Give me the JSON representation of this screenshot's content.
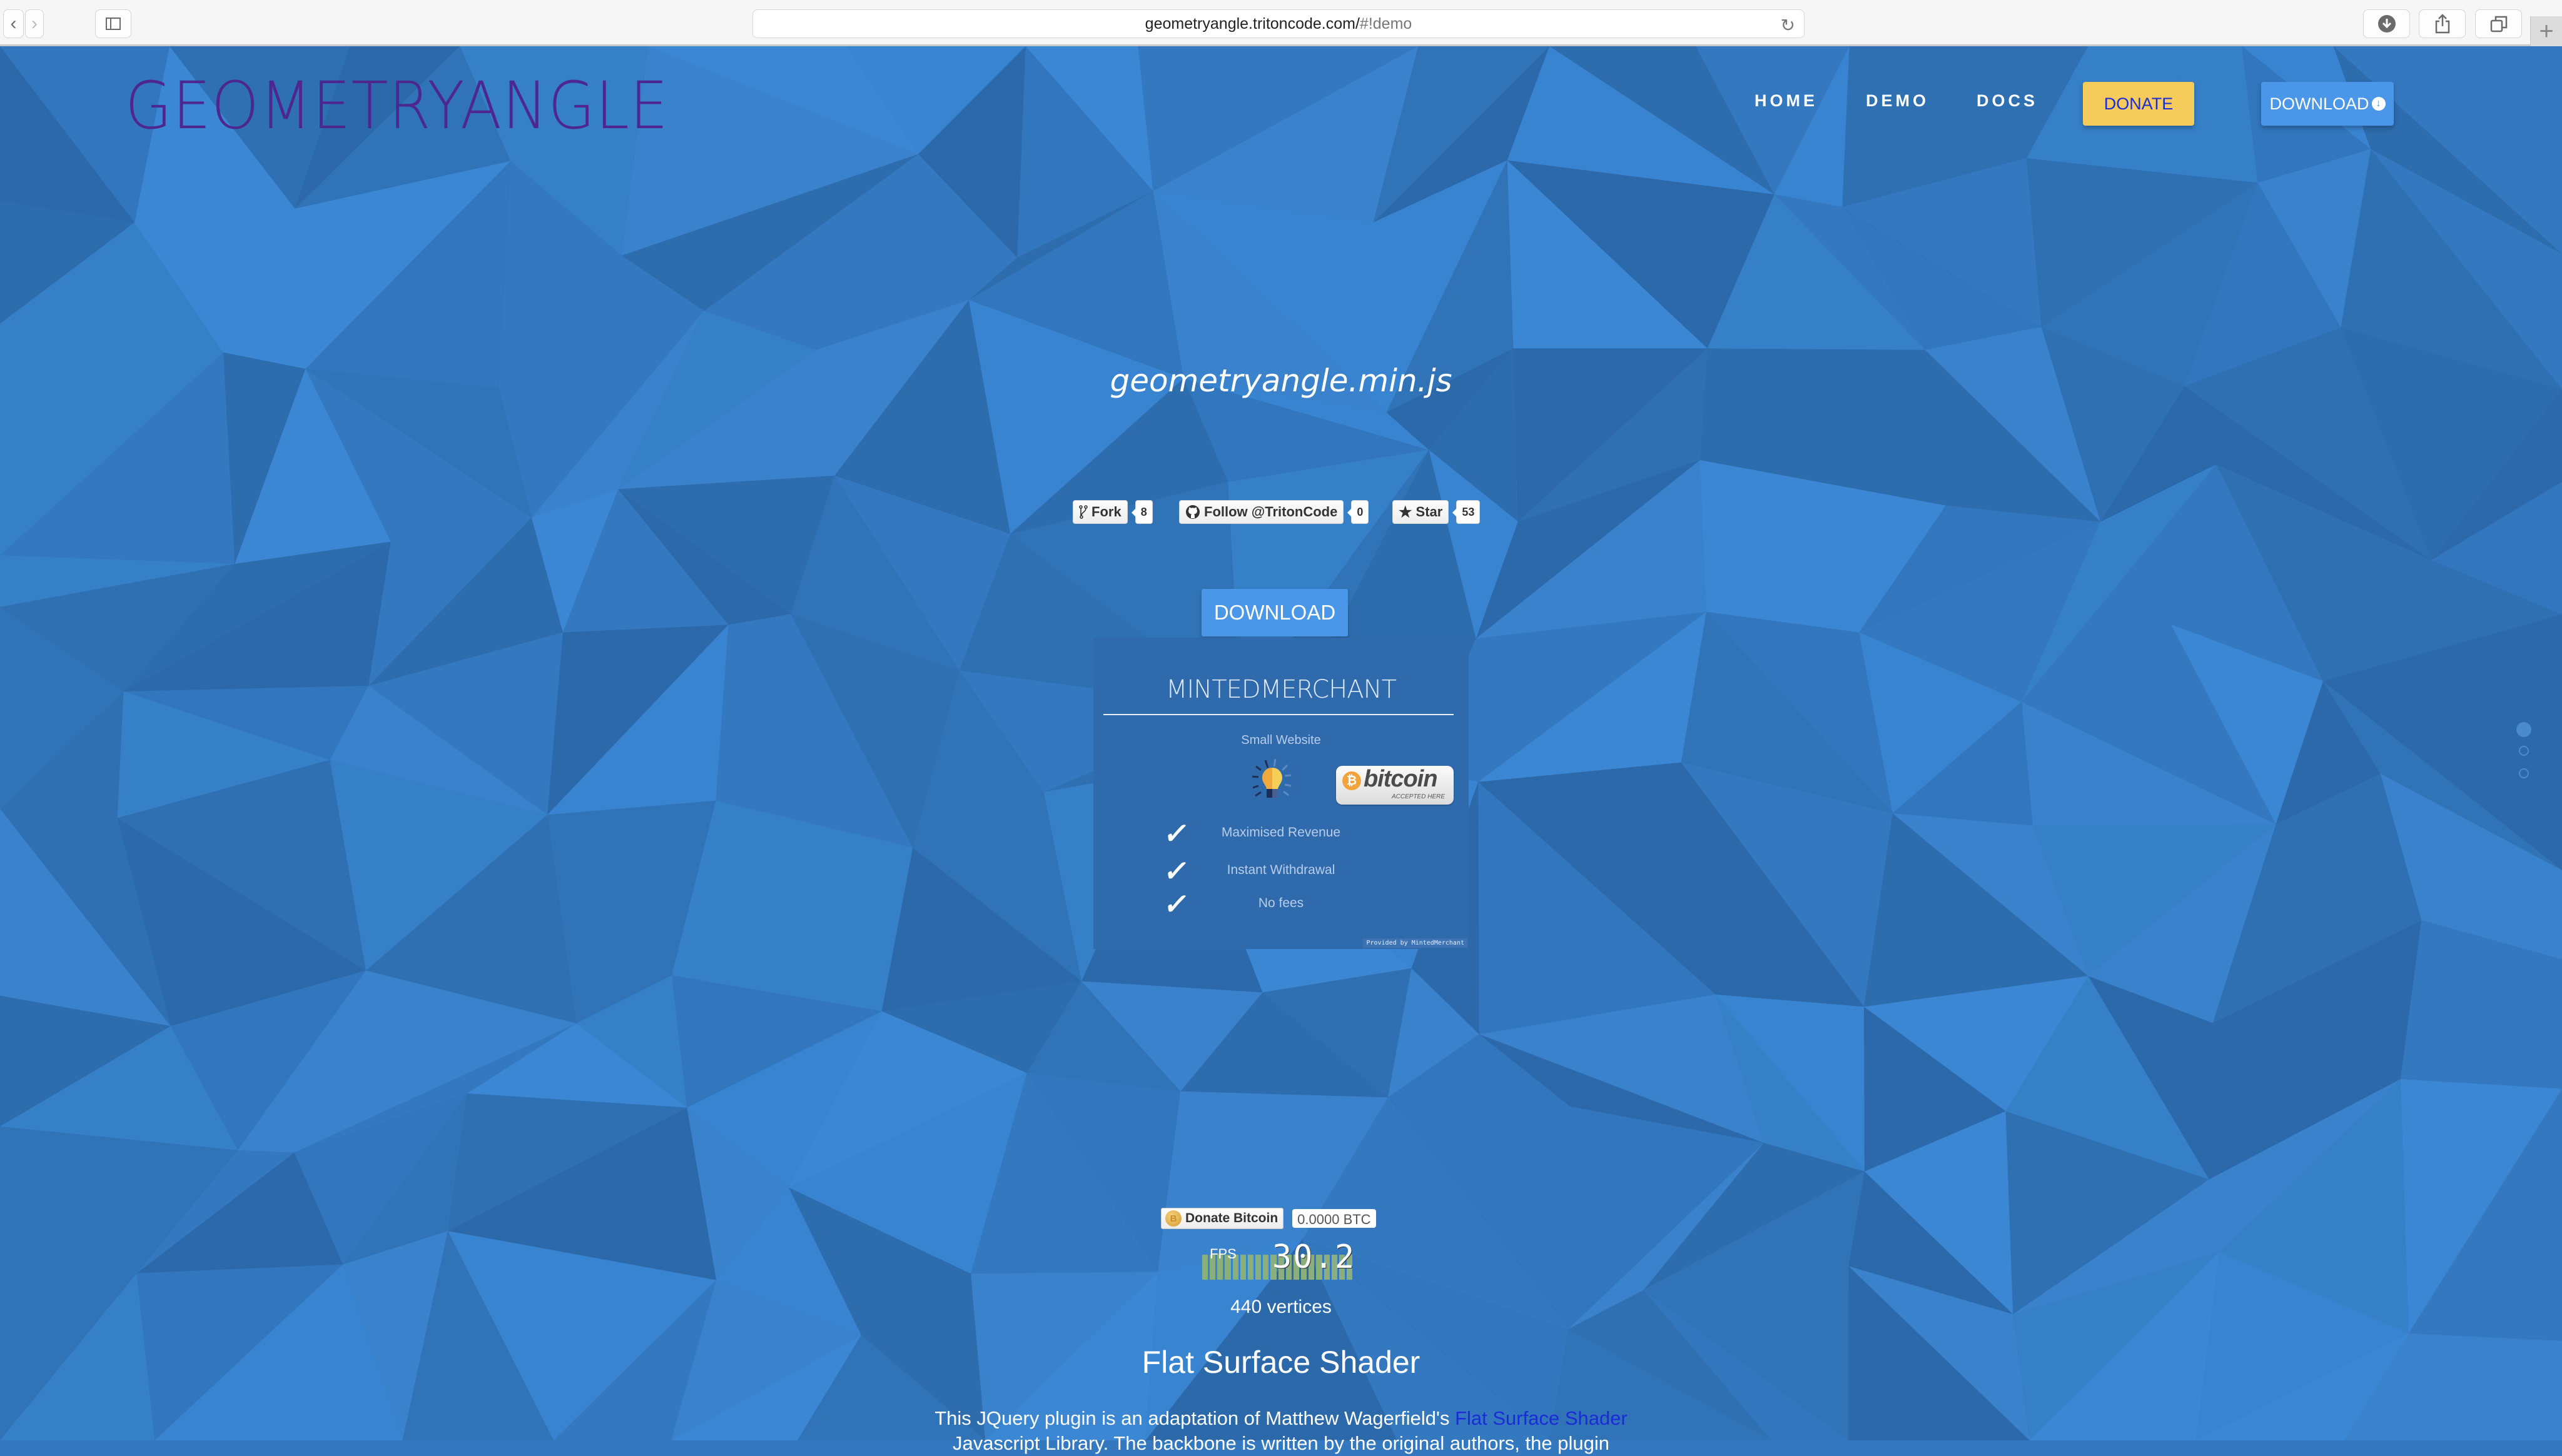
{
  "browser": {
    "url_main": "geometryangle.tritoncode.com/",
    "url_hash": "#!demo",
    "back_icon": "chevron-left-icon",
    "forward_icon": "chevron-right-icon",
    "sidebar_icon": "sidebar-icon",
    "reload_icon": "reload-icon",
    "downloads_icon": "download-circle-icon",
    "share_icon": "share-icon",
    "tabs_icon": "tabs-overview-icon",
    "new_tab_icon": "plus-icon",
    "new_tab_label": "+"
  },
  "header": {
    "logo": "GEOMETRYANGLE",
    "logo_color": "#4d2690",
    "nav": [
      {
        "label": "HOME"
      },
      {
        "label": "DEMO"
      },
      {
        "label": "DOCS"
      }
    ],
    "donate_label": "DONATE",
    "donate_color": "#f5cb5c",
    "download_label": "DOWNLOAD",
    "download_color": "#4a97e9"
  },
  "hero": {
    "subtitle": "geometryangle.min.js",
    "github": {
      "fork_label": "Fork",
      "fork_count": "8",
      "follow_label": "Follow @TritonCode",
      "follow_count": "0",
      "star_label": "Star",
      "star_count": "53"
    },
    "download_label": "DOWNLOAD"
  },
  "minted_merchant": {
    "title": "MINTEDMERCHANT",
    "plan": "Small Website",
    "badge_word": "bitcoin",
    "badge_sub": "ACCEPTED HERE",
    "features": [
      {
        "label": "Maximised Revenue"
      },
      {
        "label": "Instant Withdrawal"
      },
      {
        "label": "No fees"
      }
    ],
    "provided_by": "Provided by MintedMerchant"
  },
  "donate_bitcoin": {
    "label": "Donate Bitcoin",
    "amount": "0.0000 BTC"
  },
  "stats": {
    "fps_label": "FPS",
    "fps_value": "30.2",
    "fps_history": [
      0.95,
      0.95,
      1.0,
      0.95,
      0.95,
      0.95,
      0.95,
      0.95,
      0.95,
      0.95,
      0.95,
      0.95,
      0.95,
      0.95,
      0.95,
      0.95,
      0.95,
      0.95,
      0.95,
      0.95
    ],
    "vertices": "440 vertices"
  },
  "section": {
    "heading": "Flat Surface Shader",
    "para_prefix": "This JQuery plugin is an adaptation of Matthew Wagerfield's ",
    "para_link": "Flat Surface Shader",
    "para_line2": "Javascript Library. The backbone is written by the original authors, the plugin"
  },
  "page_indicator": {
    "count": 3,
    "active_index": 0
  },
  "colors": {
    "background": "#3479c0",
    "panel": "#2f6aad",
    "link": "#1a2bd8",
    "fps_bar": "#8aaf7d"
  }
}
